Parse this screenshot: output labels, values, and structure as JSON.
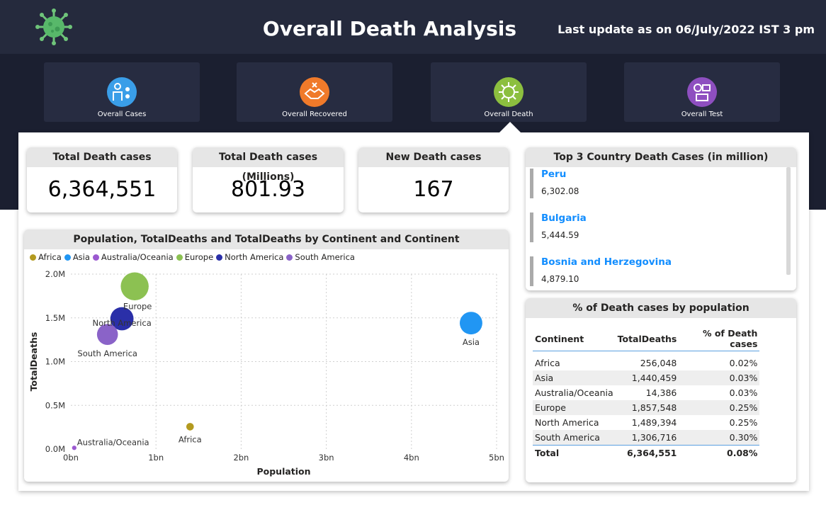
{
  "header": {
    "title": "Overall Death Analysis",
    "update": "Last update as on 06/July/2022  IST 3 pm"
  },
  "nav": [
    {
      "label": "Overall Cases",
      "icon": "people-virus-icon",
      "color": "#3a9ee8"
    },
    {
      "label": "Overall Recovered",
      "icon": "handshake-icon",
      "color": "#f07a2a"
    },
    {
      "label": "Overall Death",
      "icon": "virus-icon",
      "color": "#8cbf3f"
    },
    {
      "label": "Overall Test",
      "icon": "test-icon",
      "color": "#8e4fc0"
    }
  ],
  "kpis": {
    "total": {
      "label": "Total Death cases",
      "value": "6,364,551"
    },
    "millions": {
      "label": "Total Death cases (Millions)",
      "value": "801.93"
    },
    "new": {
      "label": "New Death cases",
      "value": "167"
    }
  },
  "top3": {
    "title": "Top 3 Country Death Cases (in million)",
    "items": [
      {
        "name": "Peru",
        "value": "6,302.08"
      },
      {
        "name": "Bulgaria",
        "value": "5,444.59"
      },
      {
        "name": "Bosnia and Herzegovina",
        "value": "4,879.10"
      }
    ]
  },
  "pct_table": {
    "title": "% of Death cases by population",
    "headers": [
      "Continent",
      "TotalDeaths",
      "% of Death cases"
    ],
    "rows": [
      [
        "Africa",
        "256,048",
        "0.02%"
      ],
      [
        "Asia",
        "1,440,459",
        "0.03%"
      ],
      [
        "Australia/Oceania",
        "14,386",
        "0.03%"
      ],
      [
        "Europe",
        "1,857,548",
        "0.25%"
      ],
      [
        "North America",
        "1,489,394",
        "0.25%"
      ],
      [
        "South America",
        "1,306,716",
        "0.30%"
      ]
    ],
    "total": [
      "Total",
      "6,364,551",
      "0.08%"
    ]
  },
  "chart_data": {
    "type": "scatter",
    "title": "Population, TotalDeaths and TotalDeaths by Continent and Continent",
    "xlabel": "Population",
    "ylabel": "TotalDeaths",
    "xlim": [
      0,
      5
    ],
    "ylim": [
      0,
      2.0
    ],
    "xticks": [
      "0bn",
      "1bn",
      "2bn",
      "3bn",
      "4bn",
      "5bn"
    ],
    "yticks": [
      "0.0M",
      "0.5M",
      "1.0M",
      "1.5M",
      "2.0M"
    ],
    "grid": true,
    "legend": "top-left",
    "series": [
      {
        "name": "Africa",
        "x": 1.4,
        "y": 0.256,
        "color": "#b39a1f"
      },
      {
        "name": "Asia",
        "x": 4.7,
        "y": 1.44,
        "color": "#2196f3"
      },
      {
        "name": "Australia/Oceania",
        "x": 0.04,
        "y": 0.014,
        "color": "#9b59d0"
      },
      {
        "name": "Europe",
        "x": 0.75,
        "y": 1.86,
        "color": "#8cc152"
      },
      {
        "name": "North America",
        "x": 0.6,
        "y": 1.49,
        "color": "#2a2fa8"
      },
      {
        "name": "South America",
        "x": 0.43,
        "y": 1.31,
        "color": "#8a63c8"
      }
    ]
  }
}
